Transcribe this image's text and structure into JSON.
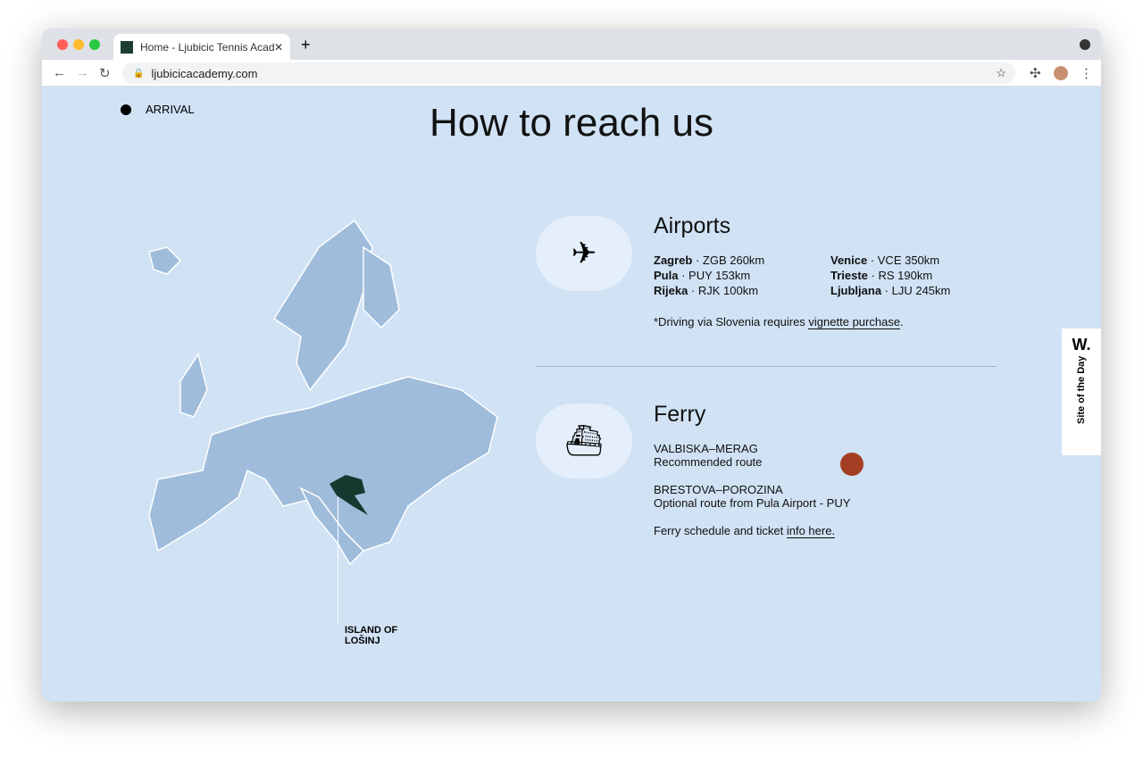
{
  "browser": {
    "tab_title": "Home - Ljubicic Tennis Academy",
    "url": "ljubicicacademy.com"
  },
  "page": {
    "arrival": "ARRIVAL",
    "title": "How to reach us",
    "island_label_1": "ISLAND OF",
    "island_label_2": "LOŠINJ",
    "sotd_logo": "W.",
    "sotd_text": "Site of the Day"
  },
  "airports": {
    "heading": "Airports",
    "list": [
      {
        "city": "Zagreb",
        "info": " · ZGB 260km"
      },
      {
        "city": "Venice",
        "info": " · VCE 350km"
      },
      {
        "city": "Pula",
        "info": " · PUY 153km"
      },
      {
        "city": "Trieste",
        "info": " · RS 190km"
      },
      {
        "city": "Rijeka",
        "info": " · RJK 100km"
      },
      {
        "city": "Ljubljana",
        "info": " · LJU 245km"
      }
    ],
    "note": "*Driving via Slovenia requires ",
    "note_link": "vignette purchase",
    "note_end": "."
  },
  "ferry": {
    "heading": "Ferry",
    "route1": "VALBISKA–MERAG",
    "route1_desc": "Recommended route",
    "route2": "BRESTOVA–POROZINA",
    "route2_desc": "Optional route from Pula Airport - PUY",
    "schedule": "Ferry schedule and ticket ",
    "schedule_link": "info here."
  },
  "colors": {
    "bg": "#d0e2f4",
    "map": "#9fbcdb",
    "croatia": "#143a2f",
    "accent": "#a43e22"
  }
}
